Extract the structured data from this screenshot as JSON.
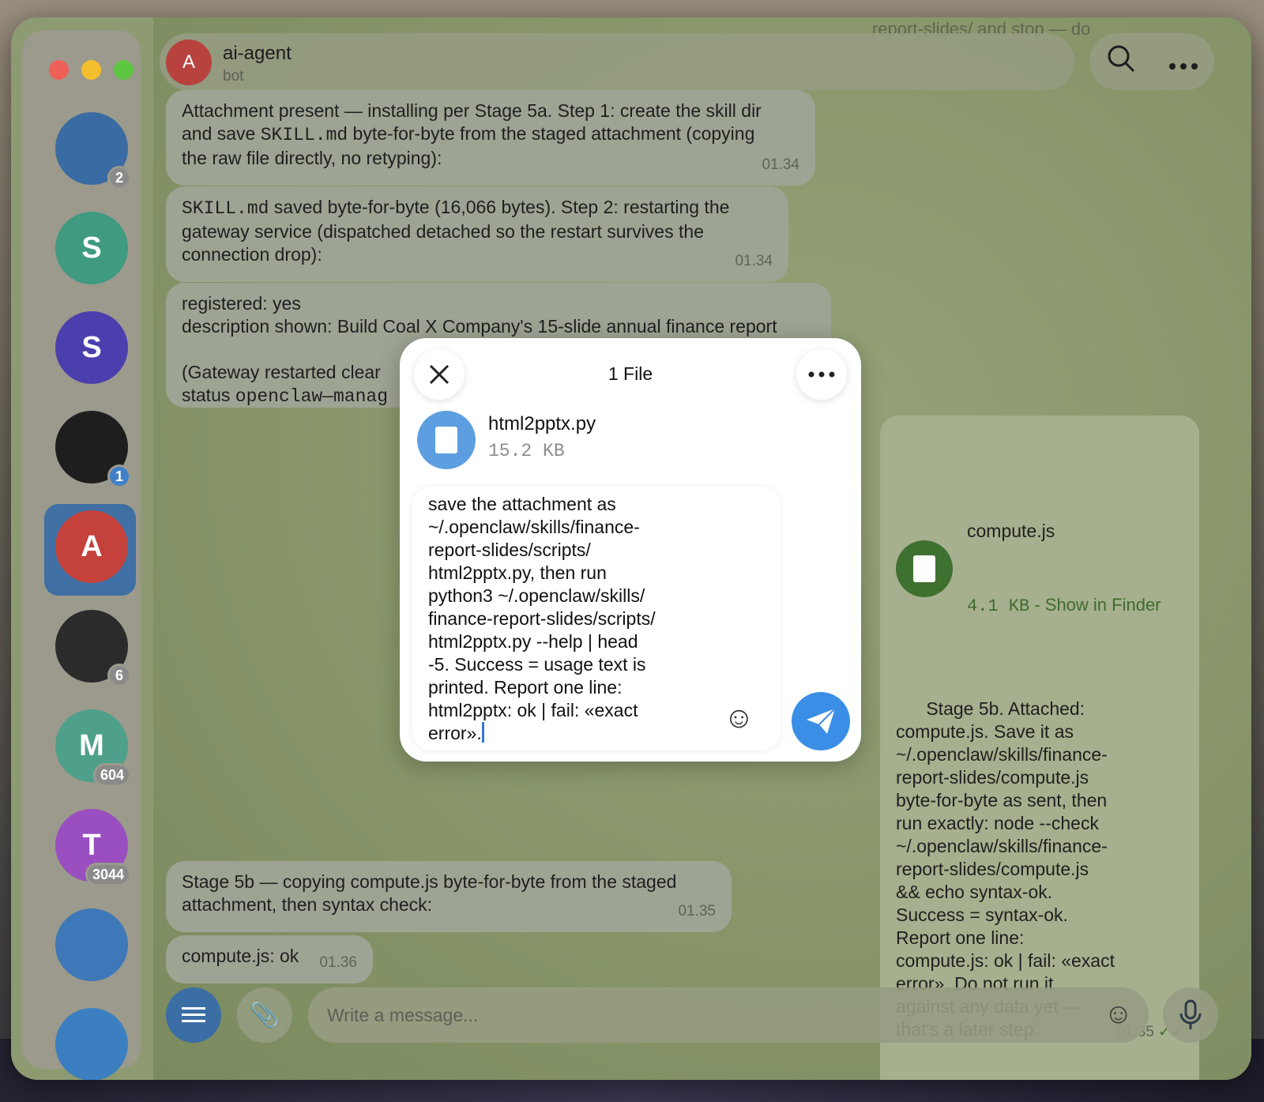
{
  "sidebar": {
    "chats": [
      {
        "initial": "",
        "badge": "2",
        "color": "#3a6ba3"
      },
      {
        "initial": "S",
        "badge": "",
        "color": "#3f9a80"
      },
      {
        "initial": "S",
        "badge": "",
        "color": "#4b3fae"
      },
      {
        "initial": "",
        "badge": "1",
        "color": "#1e1e1e"
      },
      {
        "initial": "A",
        "badge": "",
        "color": "#c4423b",
        "selected": true
      },
      {
        "initial": "",
        "badge": "6",
        "color": "#2b2b2b"
      },
      {
        "initial": "M",
        "badge": "604",
        "color": "#4fa08a"
      },
      {
        "initial": "T",
        "badge": "3044",
        "color": "#9a4fc0"
      },
      {
        "initial": "",
        "badge": "",
        "color": "#3f78b8"
      },
      {
        "initial": "",
        "badge": "",
        "color": "#3c7fc0"
      }
    ]
  },
  "header": {
    "avatar_initial": "A",
    "name": "ai-agent",
    "status": "bot",
    "ghost_text": "report-slides/ and stop — do"
  },
  "messages": {
    "m1": {
      "text": "Attachment present — installing per Stage 5a. Step 1: create the skill dir\nand save ",
      "code": "SKILL.md",
      "text2": " byte-for-byte from the staged attachment (copying\nthe raw file directly, no retyping):",
      "time": "01.34"
    },
    "m2": {
      "code": "SKILL.md",
      "text": " saved byte-for-byte (16,066 bytes). Step 2: restarting the\ngateway service (dispatched detached so the restart survives the\nconnection drop):",
      "time": "01.34"
    },
    "m3": {
      "line1": "registered: yes",
      "line2": "description shown: Build Coal X Company's 15-slide annual finance report",
      "line3": "(Gateway restarted clear",
      "line4_prefix": "status ",
      "line4_code": "openclaw—manag"
    },
    "m4": {
      "text": "Stage 5b — copying compute.js byte-for-byte from the staged\nattachment, then syntax check:",
      "time": "01.35"
    },
    "m5": {
      "text": "compute.js: ok",
      "time": "01.36"
    },
    "out": {
      "file_name": "compute.js",
      "file_size": "4.1 KB",
      "file_link": " - Show in Finder",
      "text": "Stage 5b. Attached:\ncompute.js. Save it as\n~/.openclaw/skills/finance-\nreport-slides/compute.js\nbyte-for-byte as sent, then\nrun exactly: node --check\n~/.openclaw/skills/finance-\nreport-slides/compute.js\n&& echo syntax-ok.\nSuccess = syntax-ok.\nReport one line:\ncompute.js: ok | fail: «exact\nerror». Do not run it\nagainst any data yet —\nthat's a later step.",
      "time": "01.35"
    }
  },
  "composer": {
    "placeholder": "Write a message..."
  },
  "modal": {
    "title": "1 File",
    "file_name": "html2pptx.py",
    "file_size": "15.2 KB",
    "caption": "save the attachment as\n~/.openclaw/skills/finance-\nreport-slides/scripts/\nhtml2pptx.py, then run\npython3 ~/.openclaw/skills/\nfinance-report-slides/scripts/\nhtml2pptx.py --help | head\n-5. Success = usage text is\nprinted. Report one line:\nhtml2pptx: ok | fail: «exact\nerror»."
  }
}
